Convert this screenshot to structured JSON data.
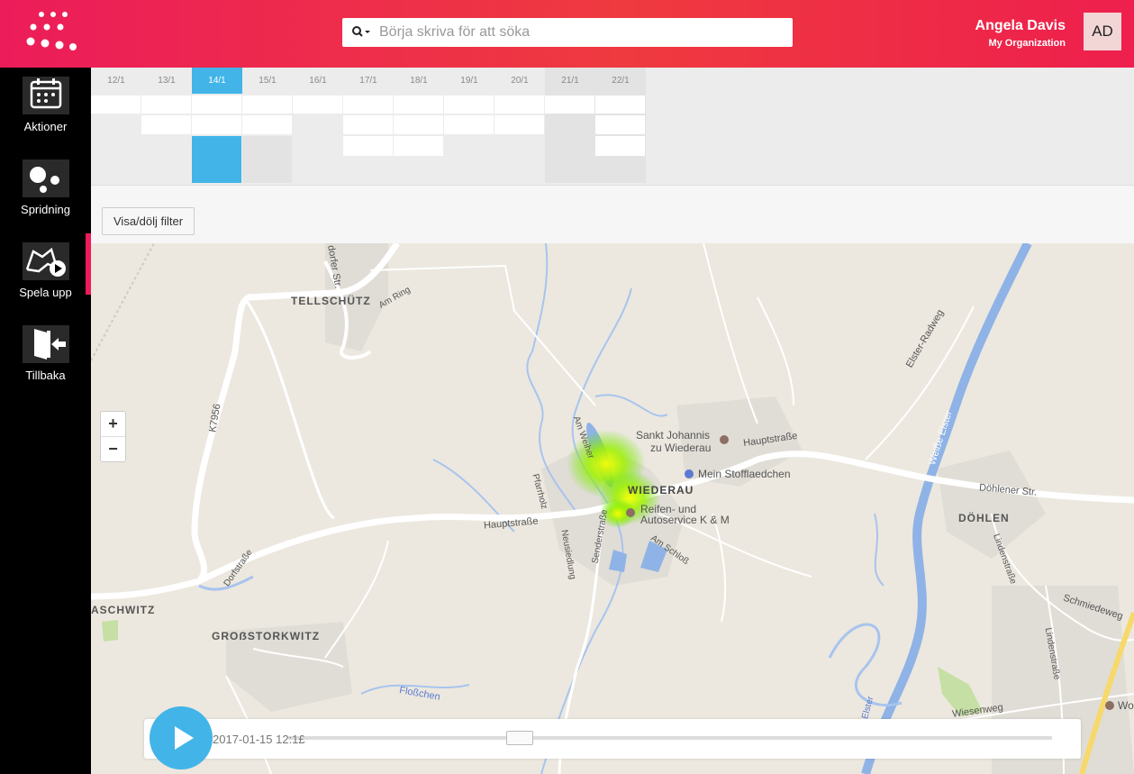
{
  "header": {
    "search_placeholder": "Börja skriva för att söka",
    "user_name": "Angela Davis",
    "organization": "My Organization",
    "avatar_initials": "AD"
  },
  "sidebar": {
    "items": [
      {
        "label": "Aktioner",
        "icon": "calendar-icon"
      },
      {
        "label": "Spridning",
        "icon": "bubbles-icon"
      },
      {
        "label": "Spela upp",
        "icon": "map-play-icon",
        "active": true
      },
      {
        "label": "Tillbaka",
        "icon": "exit-icon"
      }
    ]
  },
  "calendar": {
    "days": [
      "12/1",
      "13/1",
      "14/1",
      "15/1",
      "16/1",
      "17/1",
      "18/1",
      "19/1",
      "20/1",
      "21/1",
      "22/1"
    ],
    "selected": "14/1"
  },
  "filter": {
    "toggle_label": "Visa/dölj filter"
  },
  "map": {
    "labels": {
      "tellschutz": "TELLSCHÜTZ",
      "am_ring": "Am Ring",
      "dorfer": "dorfer Str.",
      "k7956": "K7956",
      "elster_radweg": "Elster-Radweg",
      "weisse_elster": "Weiße Elster",
      "am_weiher": "Am Weiher",
      "sankt_johannis": "Sankt Johannis",
      "zu_wiederau": "zu Wiederau",
      "hauptstrasse_1": "Hauptstraße",
      "mein_stoff": "Mein Stofflaedchen",
      "wiederau": "WIEDERAU",
      "pfarrholz": "Pfarrholz",
      "reifen_1": "Reifen- und",
      "reifen_2": "Autoservice K & M",
      "hauptstrasse_2": "Hauptstraße",
      "dohlener": "Döhlener Str.",
      "dohlen": "DÖHLEN",
      "senderstrasse": "Senderstraße",
      "neusiedlung": "Neusiedlung",
      "am_schloss": "Am Schloß",
      "lindenstrasse_1": "Lindenstraße",
      "schmiedeweg": "Schmiedeweg",
      "dorfstrasse": "Dorfstraße",
      "aschwitz": "ASCHWITZ",
      "grossstorkwitz": "GROẞSTORKWITZ",
      "lindenstrasse_2": "Lindenstraße",
      "flosschen": "Floßchen",
      "elster": "Elster",
      "wiesenweg": "Wiesenweg",
      "wo": "Wo"
    },
    "zoom_in": "+",
    "zoom_out": "−"
  },
  "player": {
    "timestamp": "2017-01-15 12:1£",
    "progress": 0.29
  },
  "colors": {
    "accent": "#ec1c5a",
    "blue": "#42b4e8"
  }
}
